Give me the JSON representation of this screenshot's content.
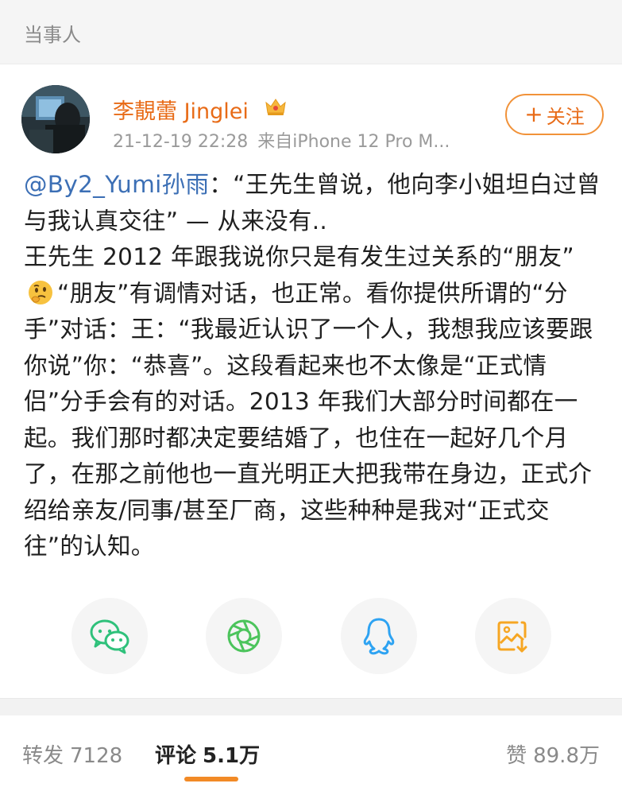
{
  "section_header": {
    "title": "当事人"
  },
  "post": {
    "author": "李靚蕾 Jinglei",
    "timestamp": "21-12-19 22:28",
    "source": "来自iPhone 12 Pro M...",
    "follow_label": "关注",
    "follow_icon": "plus-icon",
    "mention": "@By2_Yumi孙雨",
    "text_1": "：“王先生曾说，他向李小姐坦白过曾与我认真交往” — 从来没有..",
    "text_2a": "王先生 2012 年跟我说你只是有发生过关系的“朋友”",
    "emoji_icon": "thinking-face-emoji",
    "text_2b": "“朋友”有调情对话，也正常。看你提供所谓的“分手”对话：王：“我最近认识了一个人，我想我应该要跟你说”你：“恭喜”。这段看起来也不太像是“正式情侣”分手会有的对话。2013 年我们大部分时间都在一起。我们那时都决定要结婚了，也住在一起好几个月了，在那之前他也一直光明正大把我带在身边，正式介绍给亲友/同事/甚至厂商，这些种种是我对“正式交往”的认知。"
  },
  "share_buttons": [
    {
      "icon": "wechat-icon",
      "color": "#2fc17b"
    },
    {
      "icon": "moments-icon",
      "color": "#4cc45c"
    },
    {
      "icon": "qq-icon",
      "color": "#2ea3f2"
    },
    {
      "icon": "save-image-icon",
      "color": "#f6a623"
    }
  ],
  "bottom_bar": {
    "repost_label": "转发",
    "repost_count": "7128",
    "comment_label": "评论",
    "comment_count": "5.1万",
    "like_label": "赞",
    "like_count": "89.8万"
  },
  "colors": {
    "accent": "#f28a26",
    "username": "#e86b17",
    "mention": "#3c6fb5"
  }
}
